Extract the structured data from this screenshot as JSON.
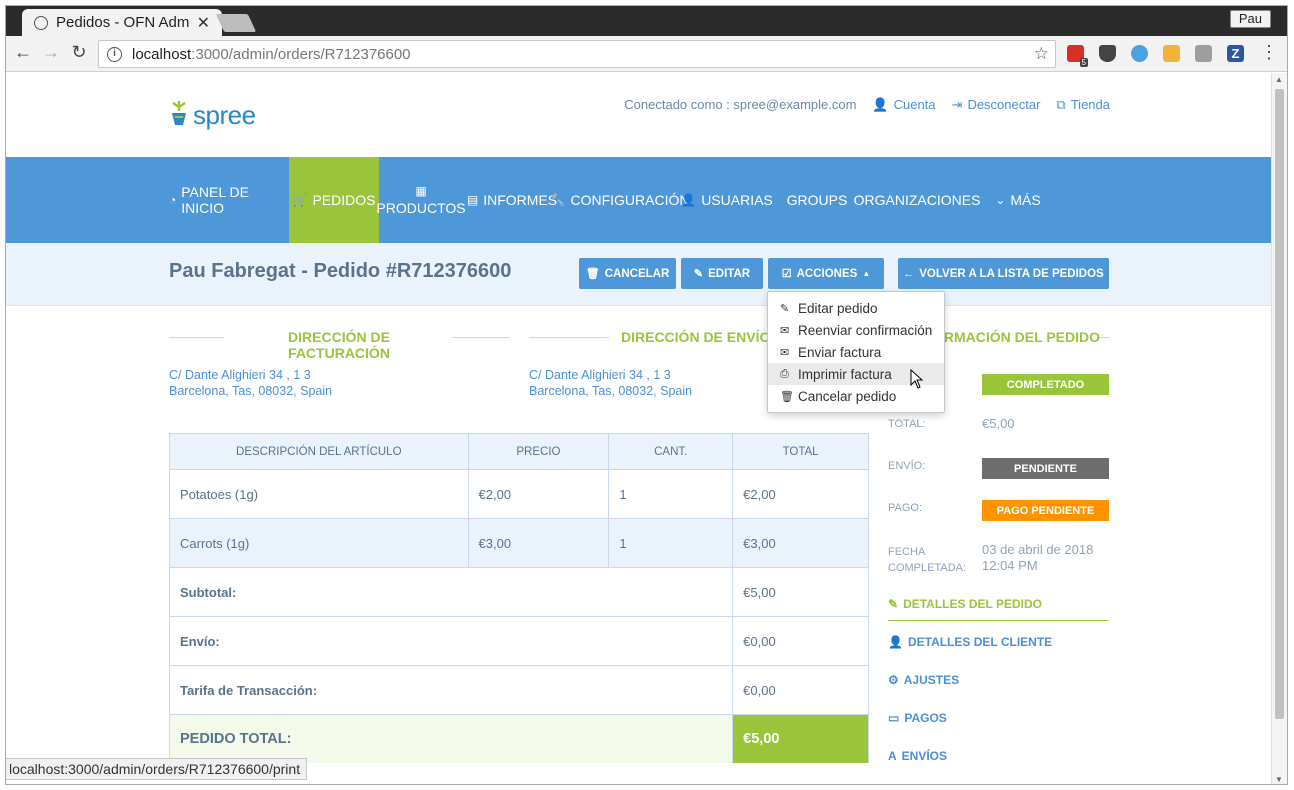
{
  "browser": {
    "tab_title": "Pedidos - OFN Adm",
    "tab_close": "✕",
    "profile": "Pau",
    "url_host": "localhost",
    "url_path": ":3000/admin/orders/R712376600",
    "status_url": "localhost:3000/admin/orders/R712376600/print",
    "extensions": [
      "calendar-ext-icon",
      "pocket-icon",
      "ext-blue-icon",
      "ext-face-icon",
      "camera-icon",
      "zotero-icon"
    ],
    "ext_badge": "5"
  },
  "header": {
    "logo_text": "spree",
    "logged_in": "Conectado como : spree@example.com",
    "account": "Cuenta",
    "logout": "Desconectar",
    "store": "Tienda"
  },
  "nav": {
    "items": [
      {
        "label": "PANEL DE INICIO"
      },
      {
        "label": "PEDIDOS"
      },
      {
        "label": "PRODUCTOS"
      },
      {
        "label": "INFORMES"
      },
      {
        "label": "CONFIGURACIÓN"
      },
      {
        "label": "USUARIAS"
      },
      {
        "label": "GROUPS"
      },
      {
        "label": "ORGANIZACIONES"
      },
      {
        "label": "MÁS"
      }
    ]
  },
  "order": {
    "title": "Pau Fabregat - Pedido #R712376600",
    "buttons": {
      "cancel": "CANCELAR",
      "edit": "EDITAR",
      "actions": "ACCIONES",
      "back": "VOLVER A LA LISTA DE PEDIDOS"
    },
    "dropdown": [
      {
        "label": "Editar pedido"
      },
      {
        "label": "Reenviar confirmación"
      },
      {
        "label": "Enviar factura"
      },
      {
        "label": "Imprimir factura"
      },
      {
        "label": "Cancelar pedido"
      }
    ],
    "billing_heading": "DIRECCIÓN DE FACTURACIÓN",
    "shipping_heading": "DIRECCIÓN DE ENVÍO",
    "info_heading": "INFORMACIÓN DEL PEDIDO",
    "billing_line1": "C/ Dante Alighieri 34 , 1 3",
    "billing_line2": "Barcelona, Tas, 08032, Spain",
    "shipping_line1": "C/ Dante Alighieri 34 , 1 3",
    "shipping_line2": "Barcelona, Tas, 08032, Spain",
    "table": {
      "headers": [
        "DESCRIPCIÓN DEL ARTÍCULO",
        "PRECIO",
        "CANT.",
        "TOTAL"
      ],
      "rows": [
        {
          "desc": "Potatoes (1g)",
          "price": "€2,00",
          "qty": "1",
          "total": "€2,00"
        },
        {
          "desc": "Carrots (1g)",
          "price": "€3,00",
          "qty": "1",
          "total": "€3,00"
        }
      ],
      "subtotal_label": "Subtotal:",
      "subtotal": "€5,00",
      "shipping_label": "Envío:",
      "shipping": "€0,00",
      "fee_label": "Tarifa de Transacción:",
      "fee": "€0,00",
      "total_label": "PEDIDO TOTAL:",
      "total": "€5,00"
    },
    "info": {
      "status": "COMPLETADO",
      "total_label": "TOTAL:",
      "total": "€5,00",
      "shipment_label": "ENVÍO:",
      "shipment_status": "PENDIENTE",
      "payment_label": "PAGO:",
      "payment_status": "PAGO PENDIENTE",
      "date_label_1": "FECHA",
      "date_label_2": "COMPLETADA:",
      "date_1": "03 de abril de 2018",
      "date_2": "12:04 PM",
      "colors": {
        "completed": "#9ac43a",
        "pending": "#6d6d6d",
        "payment_pending": "#ff9300"
      }
    },
    "side_links": [
      {
        "label": "DETALLES DEL PEDIDO"
      },
      {
        "label": "DETALLES DEL CLIENTE"
      },
      {
        "label": "AJUSTES"
      },
      {
        "label": "PAGOS"
      },
      {
        "label": "ENVÍOS"
      }
    ]
  }
}
